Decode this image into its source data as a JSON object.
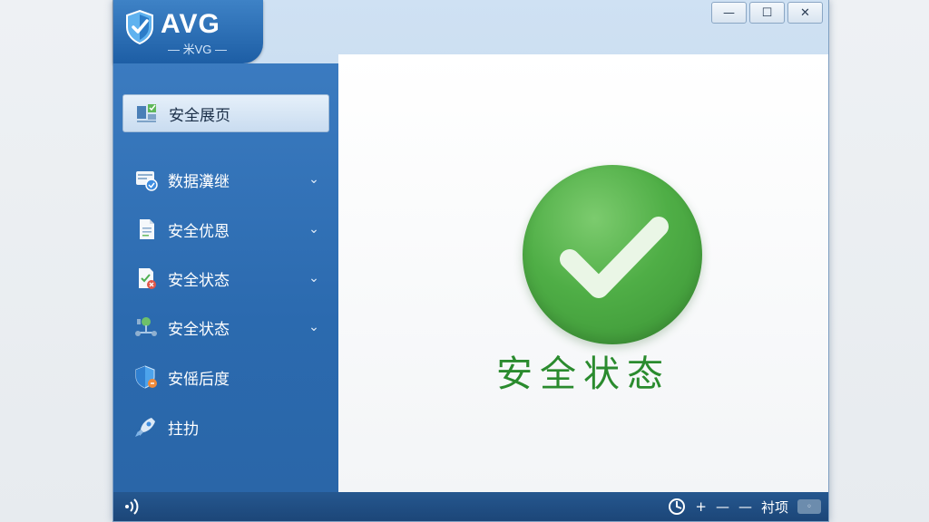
{
  "app": {
    "name": "AVG",
    "subtitle": "— 米VG —"
  },
  "window_controls": {
    "minimize": "—",
    "maximize": "☐",
    "close": "✕"
  },
  "sidebar": {
    "items": [
      {
        "label": "安全展页",
        "icon": "dashboard-icon",
        "active": true
      },
      {
        "label": "数据瀵继",
        "icon": "data-icon",
        "expandable": true
      },
      {
        "label": "安全优恩",
        "icon": "document-icon",
        "expandable": true
      },
      {
        "label": "安全状态",
        "icon": "checklist-icon",
        "expandable": true
      },
      {
        "label": "安全状态",
        "icon": "network-icon",
        "expandable": true
      },
      {
        "label": "安傜后度",
        "icon": "shield-icon"
      },
      {
        "label": "拄扐",
        "icon": "rocket-icon"
      }
    ]
  },
  "main": {
    "status_icon": "checkmark-icon",
    "status_text": "安全状态",
    "status_color": "#3a9f3c"
  },
  "statusbar": {
    "left_icon": "wifi-icon",
    "label": "衬项",
    "plus": "+",
    "dash1": "—",
    "dash2": "—"
  },
  "colors": {
    "accent": "#2b6aaf",
    "status_green": "#4fae46"
  }
}
